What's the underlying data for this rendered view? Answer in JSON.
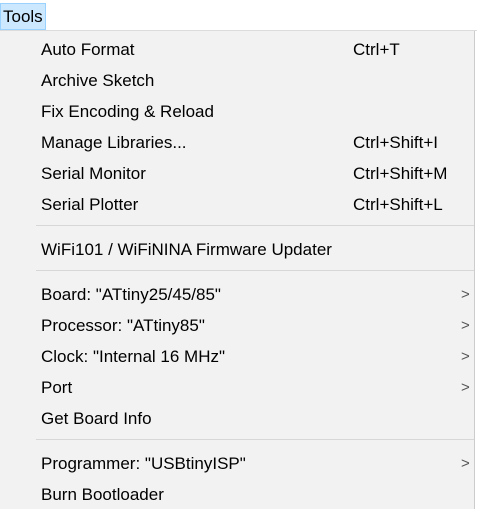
{
  "menubar": {
    "tools_label": "Tools"
  },
  "menu": {
    "groups": [
      [
        {
          "label": "Auto Format",
          "shortcut": "Ctrl+T"
        },
        {
          "label": "Archive Sketch",
          "shortcut": ""
        },
        {
          "label": "Fix Encoding & Reload",
          "shortcut": ""
        },
        {
          "label": "Manage Libraries...",
          "shortcut": "Ctrl+Shift+I"
        },
        {
          "label": "Serial Monitor",
          "shortcut": "Ctrl+Shift+M"
        },
        {
          "label": "Serial Plotter",
          "shortcut": "Ctrl+Shift+L"
        }
      ],
      [
        {
          "label": "WiFi101 / WiFiNINA Firmware Updater",
          "shortcut": ""
        }
      ],
      [
        {
          "label": "Board: \"ATtiny25/45/85\"",
          "submenu": true
        },
        {
          "label": "Processor: \"ATtiny85\"",
          "submenu": true
        },
        {
          "label": "Clock: \"Internal 16 MHz\"",
          "submenu": true
        },
        {
          "label": "Port",
          "submenu": true
        },
        {
          "label": "Get Board Info",
          "submenu": false
        }
      ],
      [
        {
          "label": "Programmer: \"USBtinyISP\"",
          "submenu": true
        },
        {
          "label": "Burn Bootloader",
          "submenu": false
        }
      ]
    ],
    "submenu_arrow_icon": "chevron-right-icon",
    "submenu_arrow_glyph": ">"
  }
}
